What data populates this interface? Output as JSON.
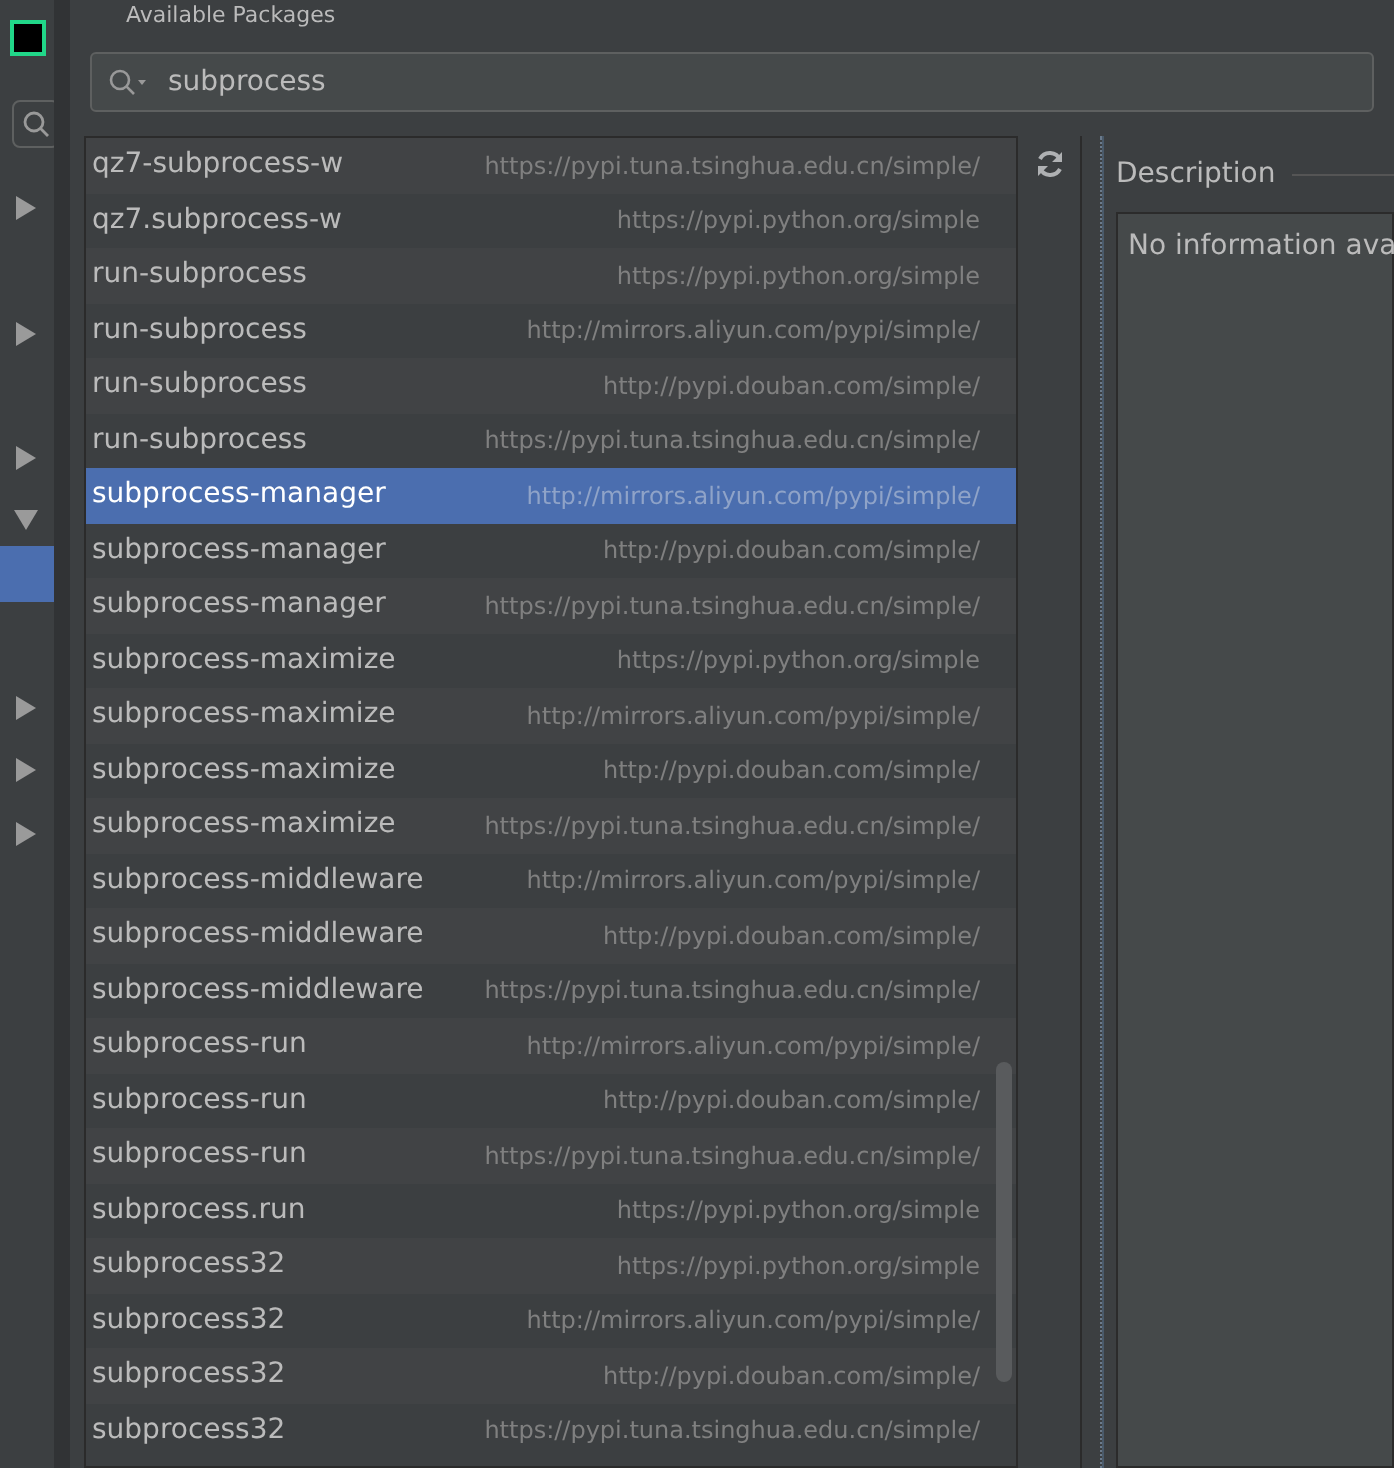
{
  "window": {
    "title": "Available Packages"
  },
  "sidebar": {
    "items": [
      {
        "kind": "collapsed"
      },
      {
        "kind": "collapsed"
      },
      {
        "kind": "collapsed"
      },
      {
        "kind": "expanded"
      },
      {
        "kind": "selected"
      },
      {
        "kind": "collapsed"
      },
      {
        "kind": "collapsed"
      },
      {
        "kind": "collapsed"
      }
    ]
  },
  "search": {
    "value": "subprocess"
  },
  "packages": [
    {
      "name": "qz7-subprocess-w",
      "repository": "https://pypi.tuna.tsinghua.edu.cn/simple/",
      "selected": false
    },
    {
      "name": "qz7.subprocess-w",
      "repository": "https://pypi.python.org/simple",
      "selected": false
    },
    {
      "name": "run-subprocess",
      "repository": "https://pypi.python.org/simple",
      "selected": false
    },
    {
      "name": "run-subprocess",
      "repository": "http://mirrors.aliyun.com/pypi/simple/",
      "selected": false
    },
    {
      "name": "run-subprocess",
      "repository": "http://pypi.douban.com/simple/",
      "selected": false
    },
    {
      "name": "run-subprocess",
      "repository": "https://pypi.tuna.tsinghua.edu.cn/simple/",
      "selected": false
    },
    {
      "name": "subprocess-manager",
      "repository": "http://mirrors.aliyun.com/pypi/simple/",
      "selected": true
    },
    {
      "name": "subprocess-manager",
      "repository": "http://pypi.douban.com/simple/",
      "selected": false
    },
    {
      "name": "subprocess-manager",
      "repository": "https://pypi.tuna.tsinghua.edu.cn/simple/",
      "selected": false
    },
    {
      "name": "subprocess-maximize",
      "repository": "https://pypi.python.org/simple",
      "selected": false
    },
    {
      "name": "subprocess-maximize",
      "repository": "http://mirrors.aliyun.com/pypi/simple/",
      "selected": false
    },
    {
      "name": "subprocess-maximize",
      "repository": "http://pypi.douban.com/simple/",
      "selected": false
    },
    {
      "name": "subprocess-maximize",
      "repository": "https://pypi.tuna.tsinghua.edu.cn/simple/",
      "selected": false
    },
    {
      "name": "subprocess-middleware",
      "repository": "http://mirrors.aliyun.com/pypi/simple/",
      "selected": false
    },
    {
      "name": "subprocess-middleware",
      "repository": "http://pypi.douban.com/simple/",
      "selected": false
    },
    {
      "name": "subprocess-middleware",
      "repository": "https://pypi.tuna.tsinghua.edu.cn/simple/",
      "selected": false
    },
    {
      "name": "subprocess-run",
      "repository": "http://mirrors.aliyun.com/pypi/simple/",
      "selected": false
    },
    {
      "name": "subprocess-run",
      "repository": "http://pypi.douban.com/simple/",
      "selected": false
    },
    {
      "name": "subprocess-run",
      "repository": "https://pypi.tuna.tsinghua.edu.cn/simple/",
      "selected": false
    },
    {
      "name": "subprocess.run",
      "repository": "https://pypi.python.org/simple",
      "selected": false
    },
    {
      "name": "subprocess32",
      "repository": "https://pypi.python.org/simple",
      "selected": false
    },
    {
      "name": "subprocess32",
      "repository": "http://mirrors.aliyun.com/pypi/simple/",
      "selected": false
    },
    {
      "name": "subprocess32",
      "repository": "http://pypi.douban.com/simple/",
      "selected": false
    },
    {
      "name": "subprocess32",
      "repository": "https://pypi.tuna.tsinghua.edu.cn/simple/",
      "selected": false
    }
  ],
  "description": {
    "title": "Description",
    "text": "No information ava"
  }
}
